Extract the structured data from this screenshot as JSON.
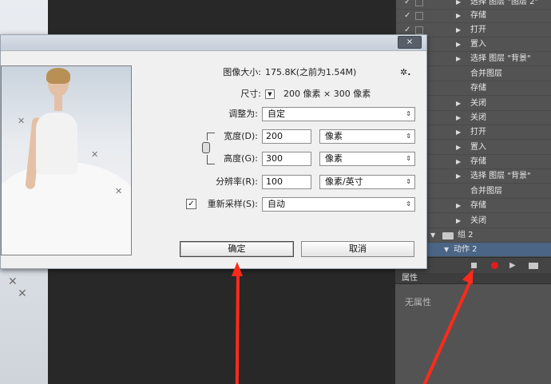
{
  "dialog": {
    "close_label": "×",
    "image_size_label": "图像大小:",
    "image_size_value": "175.8K(之前为1.54M)",
    "gear_label": "✲.",
    "dimensions_label": "尺寸:",
    "dimensions_value": "200 像素 × 300 像素",
    "fit_to_label": "调整为:",
    "fit_to_value": "自定",
    "width_label": "宽度(D):",
    "width_value": "200",
    "width_unit": "像素",
    "height_label": "高度(G):",
    "height_value": "300",
    "height_unit": "像素",
    "resolution_label": "分辨率(R):",
    "resolution_value": "100",
    "resolution_unit": "像素/英寸",
    "resample_label": "重新采样(S):",
    "resample_value": "自动",
    "resample_checked": "✓",
    "ok_label": "确定",
    "cancel_label": "取消"
  },
  "actions_panel": {
    "items": [
      {
        "check": "✓",
        "text": "选择 图层 \"图层 2\""
      },
      {
        "check": "✓",
        "text": "存储"
      },
      {
        "check": "✓",
        "text": "打开"
      },
      {
        "check": "",
        "text": "置入"
      },
      {
        "check": "",
        "text": "选择 图层 \"背景\""
      },
      {
        "check": "",
        "text": "合并图层"
      },
      {
        "check": "",
        "text": "存储"
      },
      {
        "check": "",
        "text": "关闭"
      },
      {
        "check": "",
        "text": "关闭"
      },
      {
        "check": "",
        "text": "打开"
      },
      {
        "check": "",
        "text": "置入"
      },
      {
        "check": "",
        "text": "存储"
      },
      {
        "check": "",
        "text": "选择 图层 \"背景\""
      },
      {
        "check": "",
        "text": "合并图层"
      },
      {
        "check": "",
        "text": "存储"
      },
      {
        "check": "",
        "text": "关闭"
      }
    ],
    "group_label": "组 2",
    "selected_action": "动作 2"
  },
  "properties_panel": {
    "tab_label": "属性",
    "empty_text": "无属性"
  },
  "colors": {
    "arrow": "#ff2a1a",
    "record": "#e21b1b",
    "selection": "#4a6585"
  }
}
